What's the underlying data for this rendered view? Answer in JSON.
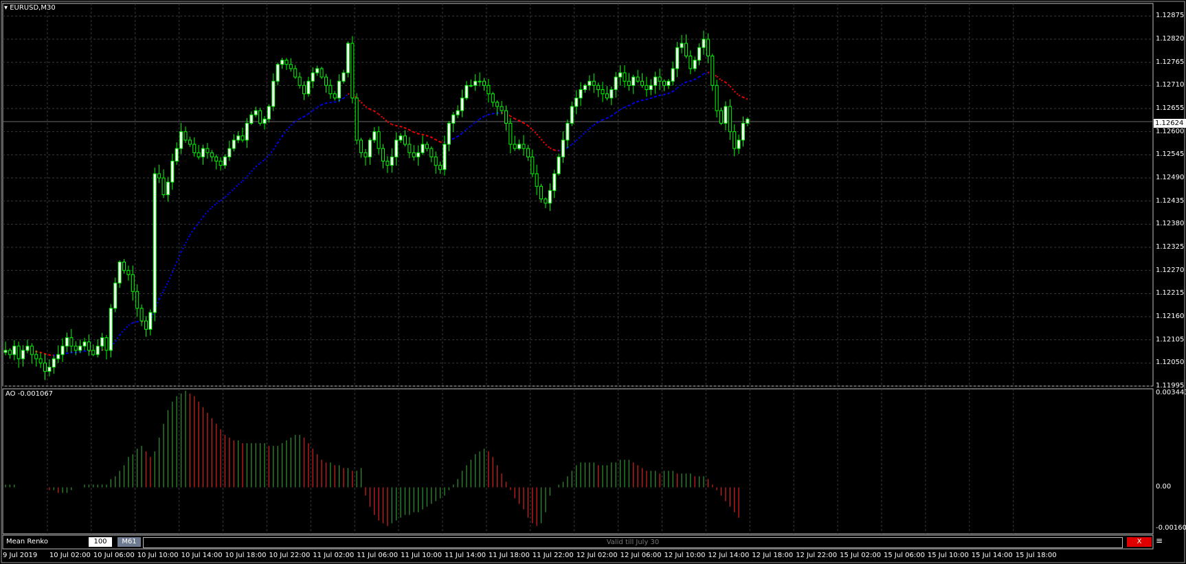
{
  "main_panel": {
    "title": "EURUSD,M30",
    "current_price": "1.12624",
    "y_ticks": [
      "1.12875",
      "1.12820",
      "1.12765",
      "1.12710",
      "1.12655",
      "1.12600",
      "1.12545",
      "1.12490",
      "1.12435",
      "1.12380",
      "1.12325",
      "1.12270",
      "1.12215",
      "1.12160",
      "1.12105",
      "1.12050",
      "1.11995"
    ]
  },
  "ao_panel": {
    "title": "AO -0.001067",
    "y_ticks": [
      "0.003443",
      "0.00",
      "-0.001607"
    ]
  },
  "x_ticks": [
    "9 Jul 2019",
    "10 Jul 02:00",
    "10 Jul 06:00",
    "10 Jul 10:00",
    "10 Jul 14:00",
    "10 Jul 18:00",
    "10 Jul 22:00",
    "11 Jul 02:00",
    "11 Jul 06:00",
    "11 Jul 10:00",
    "11 Jul 14:00",
    "11 Jul 18:00",
    "11 Jul 22:00",
    "12 Jul 02:00",
    "12 Jul 06:00",
    "12 Jul 10:00",
    "12 Jul 14:00",
    "12 Jul 18:00",
    "12 Jul 22:00",
    "15 Jul 02:00",
    "15 Jul 06:00",
    "15 Jul 10:00",
    "15 Jul 14:00",
    "15 Jul 18:00"
  ],
  "bottom_bar": {
    "name": "Mean Renko",
    "box_size": "100",
    "timeframe": "M61",
    "notice": "Valid till July 30",
    "close_label": "X"
  },
  "colors": {
    "background": "#000000",
    "grid": "#3a3a3a",
    "bull_candle": "#ffffff",
    "bear_candle": "#000000",
    "wick": "#00ff00",
    "renko_up": "#0000ff",
    "renko_down": "#ff0000",
    "ao_up": "#2e8b2e",
    "ao_down": "#cc1f1f"
  },
  "chart_data": [
    {
      "type": "candlestick",
      "symbol": "EURUSD",
      "timeframe": "M30",
      "ylim": [
        1.11995,
        1.12905
      ],
      "close": [
        1.1208,
        1.1207,
        1.1209,
        1.1206,
        1.1208,
        1.1209,
        1.1207,
        1.1206,
        1.1205,
        1.1203,
        1.1204,
        1.1206,
        1.1207,
        1.1209,
        1.1211,
        1.1209,
        1.1208,
        1.1209,
        1.121,
        1.1208,
        1.1207,
        1.1209,
        1.1211,
        1.1208,
        1.1218,
        1.1224,
        1.1229,
        1.1227,
        1.1226,
        1.1222,
        1.1218,
        1.1215,
        1.1213,
        1.1217,
        1.125,
        1.1249,
        1.1245,
        1.1248,
        1.1253,
        1.1256,
        1.126,
        1.1258,
        1.1257,
        1.1255,
        1.1254,
        1.1256,
        1.1255,
        1.1254,
        1.1253,
        1.1252,
        1.1254,
        1.1256,
        1.1258,
        1.1259,
        1.1258,
        1.1262,
        1.1264,
        1.1265,
        1.1262,
        1.1263,
        1.1266,
        1.1272,
        1.1276,
        1.1277,
        1.1276,
        1.1275,
        1.1273,
        1.1271,
        1.1269,
        1.1272,
        1.1274,
        1.1275,
        1.1273,
        1.1271,
        1.1269,
        1.1268,
        1.1272,
        1.1274,
        1.1281,
        1.1268,
        1.1258,
        1.1255,
        1.1254,
        1.1258,
        1.126,
        1.1256,
        1.1253,
        1.1252,
        1.1254,
        1.1258,
        1.1259,
        1.1257,
        1.1255,
        1.1254,
        1.1255,
        1.1257,
        1.1256,
        1.1254,
        1.1252,
        1.1251,
        1.1257,
        1.1262,
        1.1264,
        1.1265,
        1.1268,
        1.1271,
        1.1271,
        1.1272,
        1.1272,
        1.1271,
        1.1269,
        1.1267,
        1.1266,
        1.1265,
        1.1262,
        1.1257,
        1.1256,
        1.1257,
        1.1256,
        1.1254,
        1.125,
        1.1247,
        1.1244,
        1.1243,
        1.1246,
        1.125,
        1.1254,
        1.1258,
        1.1262,
        1.1266,
        1.1268,
        1.127,
        1.1271,
        1.1272,
        1.1271,
        1.127,
        1.1269,
        1.1268,
        1.127,
        1.1273,
        1.1274,
        1.1272,
        1.1271,
        1.1273,
        1.1272,
        1.1271,
        1.127,
        1.1271,
        1.1273,
        1.1272,
        1.1271,
        1.1272,
        1.1275,
        1.128,
        1.1281,
        1.1278,
        1.1275,
        1.1277,
        1.128,
        1.1282,
        1.1278,
        1.1271,
        1.1265,
        1.1262,
        1.1266,
        1.126,
        1.1256,
        1.1258,
        1.1262,
        1.1263
      ]
    },
    {
      "type": "bar",
      "indicator": "AO",
      "ylim": [
        -0.001607,
        0.003443
      ],
      "values": [
        0.0001,
        0.0001,
        0.0001,
        0.0,
        0.0,
        0.0,
        0.0,
        0.0,
        0.0,
        0.0,
        -0.0001,
        -0.0001,
        -0.0002,
        -0.0002,
        -0.0002,
        -0.0001,
        0.0,
        0.0,
        0.0001,
        0.0001,
        0.0001,
        0.0001,
        0.0001,
        0.0001,
        0.0003,
        0.0004,
        0.0006,
        0.0008,
        0.0011,
        0.0012,
        0.0014,
        0.0015,
        0.0013,
        0.0011,
        0.0013,
        0.0018,
        0.0023,
        0.0028,
        0.0031,
        0.0033,
        0.0034,
        0.0035,
        0.0034,
        0.0033,
        0.0031,
        0.0029,
        0.0027,
        0.0025,
        0.0023,
        0.0021,
        0.0019,
        0.0018,
        0.0017,
        0.0017,
        0.0016,
        0.0016,
        0.0016,
        0.0016,
        0.0016,
        0.0016,
        0.0015,
        0.0015,
        0.0015,
        0.0016,
        0.0017,
        0.0018,
        0.0019,
        0.0019,
        0.0018,
        0.0016,
        0.0014,
        0.0012,
        0.001,
        0.0009,
        0.0009,
        0.0008,
        0.0008,
        0.0007,
        0.0007,
        0.0006,
        0.0006,
        0.0007,
        -0.0003,
        -0.0007,
        -0.001,
        -0.0012,
        -0.0013,
        -0.0014,
        -0.0013,
        -0.0012,
        -0.0011,
        -0.001,
        -0.001,
        -0.0009,
        -0.0009,
        -0.0008,
        -0.0007,
        -0.0006,
        -0.0005,
        -0.0004,
        -0.0003,
        -0.0001,
        0.0001,
        0.0003,
        0.0006,
        0.0008,
        0.001,
        0.0012,
        0.0013,
        0.0014,
        0.0013,
        0.0011,
        0.0008,
        0.0005,
        0.0002,
        -0.0001,
        -0.0004,
        -0.0006,
        -0.0008,
        -0.0011,
        -0.0013,
        -0.0014,
        -0.0013,
        -0.0009,
        -0.0003,
        0.0,
        0.0001,
        0.0002,
        0.0004,
        0.0006,
        0.0008,
        0.0009,
        0.0009,
        0.0009,
        0.0009,
        0.0008,
        0.0008,
        0.0008,
        0.0009,
        0.0009,
        0.001,
        0.001,
        0.001,
        0.0009,
        0.0008,
        0.0007,
        0.0006,
        0.0006,
        0.0006,
        0.0005,
        0.0006,
        0.0006,
        0.0006,
        0.0005,
        0.0005,
        0.0005,
        0.0005,
        0.0004,
        0.0004,
        0.0004,
        0.0003,
        0.0001,
        -0.0001,
        -0.0003,
        -0.0005,
        -0.0007,
        -0.0009,
        -0.0011
      ]
    }
  ]
}
